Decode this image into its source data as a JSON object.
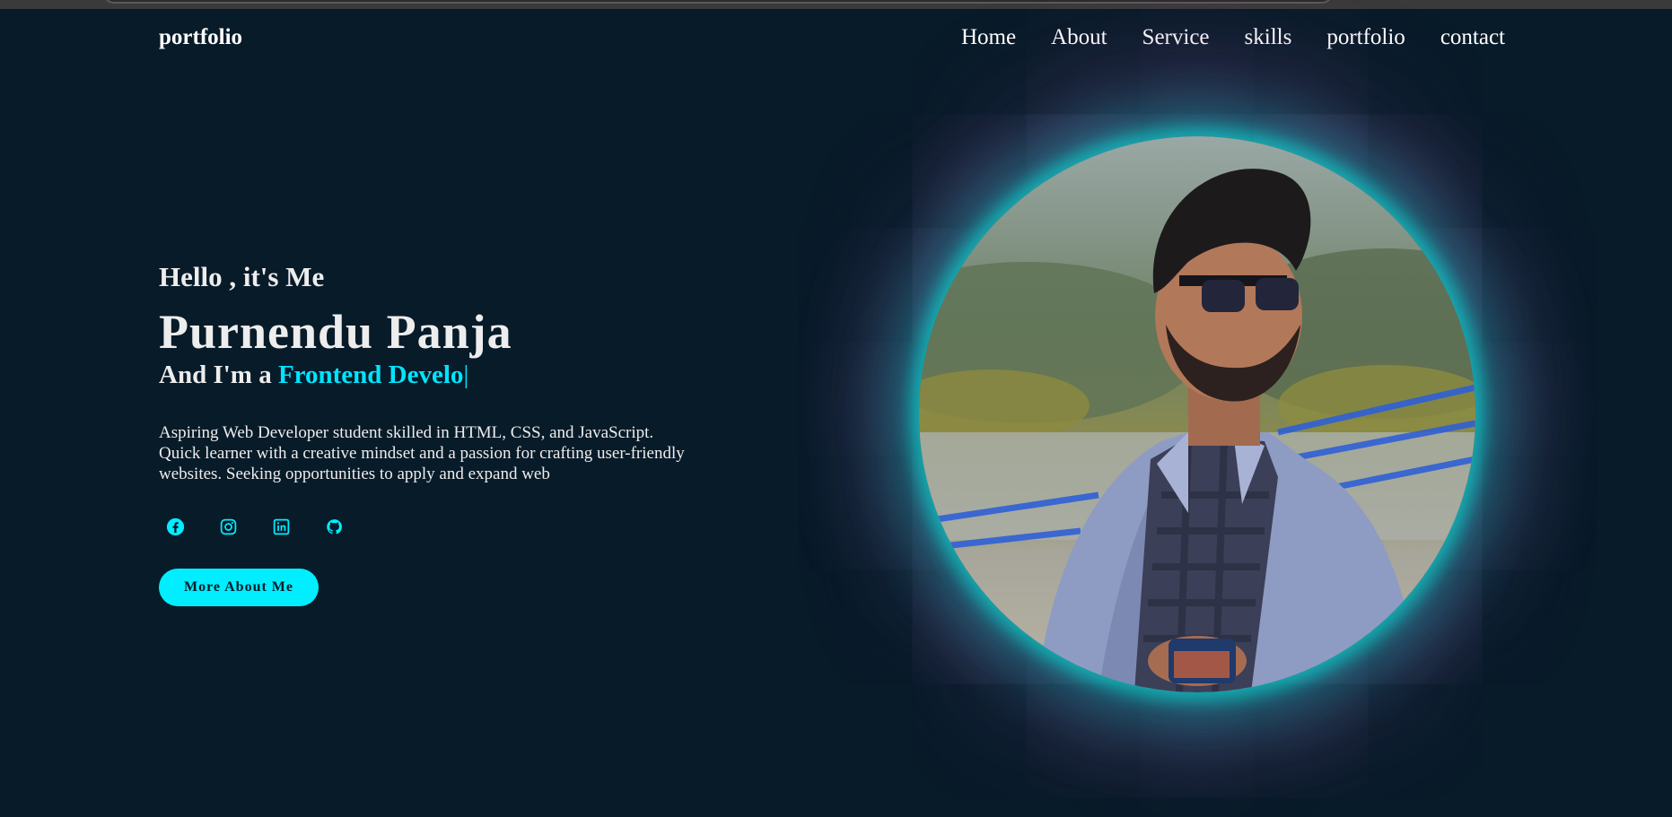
{
  "header": {
    "logo": "portfolio",
    "nav": [
      "Home",
      "About",
      "Service",
      "skills",
      "portfolio",
      "contact"
    ]
  },
  "hero": {
    "greeting": "Hello , it's Me",
    "name": "Purnendu Panja",
    "role_prefix": "And I'm a ",
    "role_typed": "Frontend Develo",
    "role_cursor": "|",
    "description": "Aspiring Web Developer student skilled in HTML, CSS, and JavaScript. Quick learner with a creative mindset and a passion for crafting user-friendly websites. Seeking opportunities to apply and expand web",
    "button_label": "More About Me"
  },
  "socials": [
    "facebook-icon",
    "instagram-icon",
    "linkedin-icon",
    "github-icon"
  ],
  "colors": {
    "background": "#081b29",
    "accent": "#00eeff",
    "text": "#ededed",
    "glow_pink": "#be46a0"
  }
}
